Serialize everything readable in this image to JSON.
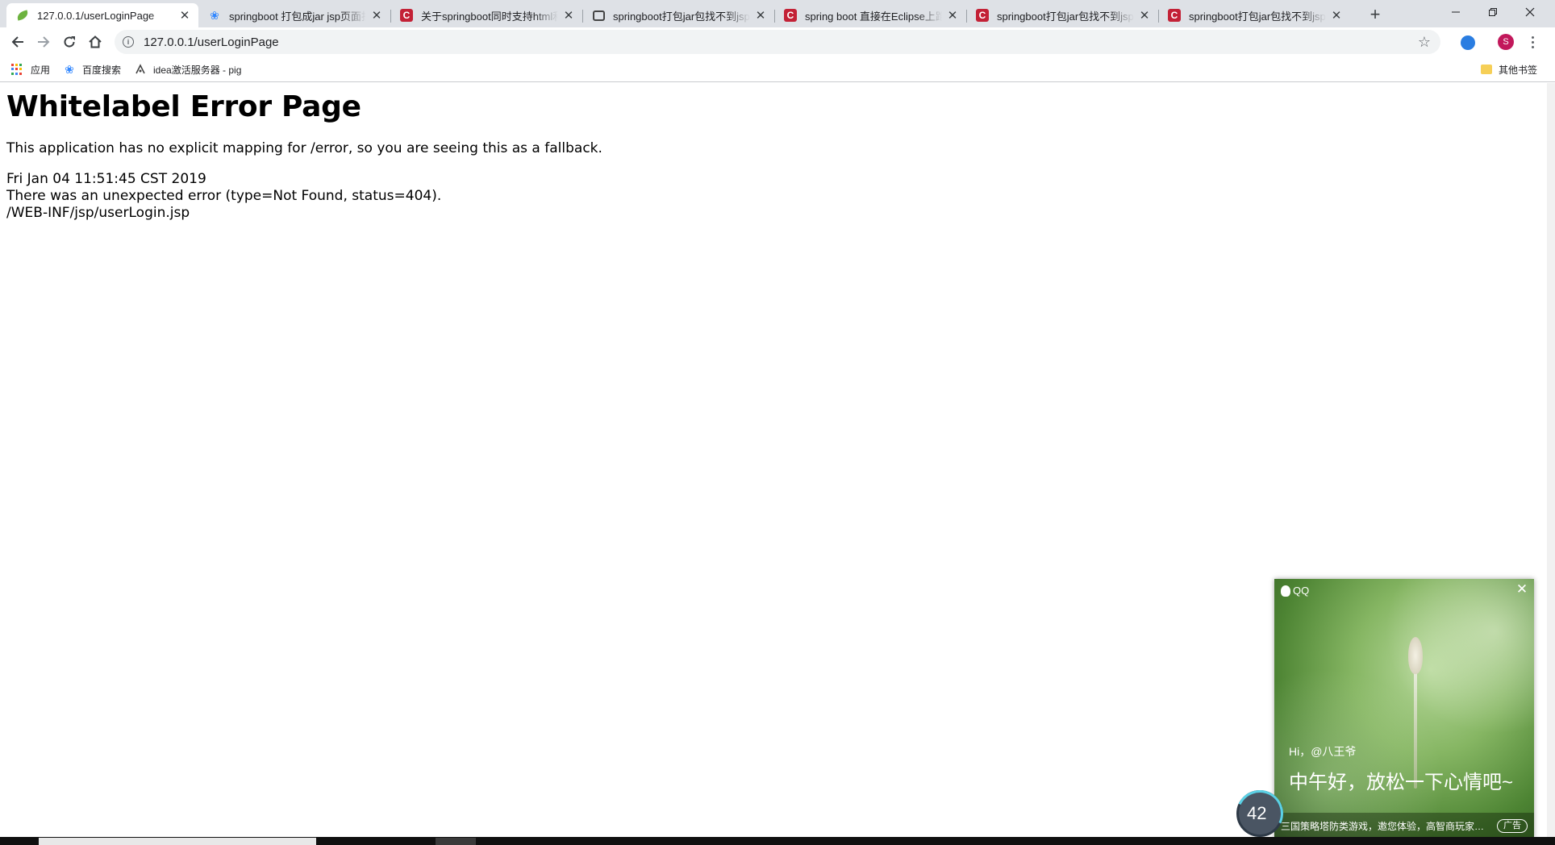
{
  "browser": {
    "tabs": [
      {
        "title": "127.0.0.1/userLoginPage",
        "favicon": "spring-leaf-icon",
        "active": true
      },
      {
        "title": "springboot 打包成jar jsp页面找",
        "favicon": "baidu-paw-icon",
        "active": false
      },
      {
        "title": "关于springboot同时支持html和",
        "favicon": "csdn-icon",
        "active": false
      },
      {
        "title": "springboot打包jar包找不到jsp文",
        "favicon": "code-icon",
        "active": false
      },
      {
        "title": "spring boot 直接在Eclipse上跑",
        "favicon": "csdn-icon",
        "active": false
      },
      {
        "title": "springboot打包jar包找不到jsp文",
        "favicon": "csdn-icon",
        "active": false
      },
      {
        "title": "springboot打包jar包找不到jsp文",
        "favicon": "csdn-icon",
        "active": false
      }
    ],
    "url": "127.0.0.1/userLoginPage",
    "profile_initial": "S",
    "bookmarks": {
      "apps": "应用",
      "baidu": "百度搜索",
      "idea": "idea激活服务器 - pig",
      "other": "其他书签"
    }
  },
  "page": {
    "heading": "Whitelabel Error Page",
    "message": "This application has no explicit mapping for /error, so you are seeing this as a fallback.",
    "timestamp": "Fri Jan 04 11:51:45 CST 2019",
    "error_line": "There was an unexpected error (type=Not Found, status=404).",
    "path": "/WEB-INF/jsp/userLogin.jsp"
  },
  "qq_popup": {
    "brand": "QQ",
    "greeting_small": "Hi，@八王爷",
    "greeting_large": "中午好，放松一下心情吧~",
    "footer_text": "三国策略塔防类游戏，邀您体验，高智商玩家…",
    "ad_label": "广告"
  },
  "speed_widget": {
    "value": "42"
  },
  "colors": {
    "tabstrip_bg": "#dee1e6",
    "csdn_red": "#c32136",
    "spring_green": "#6db33f"
  }
}
